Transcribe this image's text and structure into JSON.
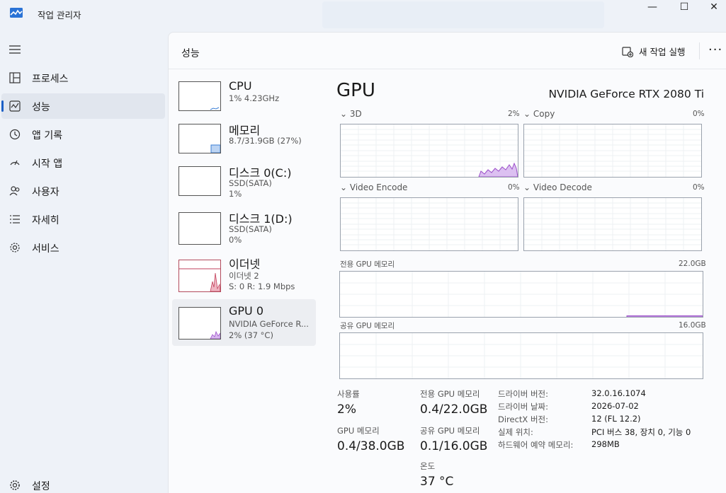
{
  "app": {
    "title": "작업 관리자"
  },
  "nav": {
    "items": [
      {
        "label": "프로세스",
        "icon": "processes-icon"
      },
      {
        "label": "성능",
        "icon": "performance-icon",
        "active": true
      },
      {
        "label": "앱 기록",
        "icon": "app-history-icon"
      },
      {
        "label": "시작 앱",
        "icon": "startup-apps-icon"
      },
      {
        "label": "사용자",
        "icon": "users-icon"
      },
      {
        "label": "자세히",
        "icon": "details-icon"
      },
      {
        "label": "서비스",
        "icon": "services-icon"
      }
    ],
    "settings_label": "설정"
  },
  "header": {
    "title": "성능",
    "run_task_label": "새 작업 실행",
    "more_label": "···"
  },
  "devices": [
    {
      "name": "CPU",
      "sub1": "1% 4.23GHz",
      "sub2": ""
    },
    {
      "name": "메모리",
      "sub1": "8.7/31.9GB (27%)",
      "sub2": ""
    },
    {
      "name": "디스크 0(C:)",
      "sub1": "SSD(SATA)",
      "sub2": "1%"
    },
    {
      "name": "디스크 1(D:)",
      "sub1": "SSD(SATA)",
      "sub2": "0%"
    },
    {
      "name": "이더넷",
      "sub1": "이더넷 2",
      "sub2": "S: 0 R: 1.9 Mbps"
    },
    {
      "name": "GPU 0",
      "sub1": "NVIDIA GeForce R...",
      "sub2": "2% (37 °C)"
    }
  ],
  "gpu": {
    "heading": "GPU",
    "model": "NVIDIA GeForce RTX 2080 Ti",
    "engines": [
      {
        "label": "3D",
        "pct": "2%"
      },
      {
        "label": "Copy",
        "pct": "0%"
      },
      {
        "label": "Video Encode",
        "pct": "0%"
      },
      {
        "label": "Video Decode",
        "pct": "0%"
      }
    ],
    "dedicated_mem": {
      "label": "전용 GPU 메모리",
      "max": "22.0GB"
    },
    "shared_mem": {
      "label": "공유 GPU 메모리",
      "max": "16.0GB"
    }
  },
  "stats": {
    "utilization_label": "사용률",
    "utilization": "2%",
    "dedicated_label": "전용 GPU 메모리",
    "dedicated": "0.4/22.0GB",
    "gpu_mem_label": "GPU 메모리",
    "gpu_mem": "0.4/38.0GB",
    "shared_label": "공유 GPU 메모리",
    "shared": "0.1/16.0GB",
    "temp_label": "온도",
    "temp": "37 °C"
  },
  "details": [
    {
      "k": "드라이버 버전:",
      "v": "32.0.16.1074"
    },
    {
      "k": "드라이버 날짜:",
      "v": "2026-07-02"
    },
    {
      "k": "DirectX 버전:",
      "v": "12 (FL 12.2)"
    },
    {
      "k": "실제 위치:",
      "v": "PCI 버스 38, 장치 0, 기능 0"
    },
    {
      "k": "하드웨어 예약 메모리:",
      "v": "298MB"
    }
  ],
  "colors": {
    "accent": "#1b5fc6",
    "gpu_purple": "#9b4fc9",
    "mem_blue": "#3c7fd6",
    "net_red": "#c2425c",
    "disk_green": "#5d8a2a"
  }
}
